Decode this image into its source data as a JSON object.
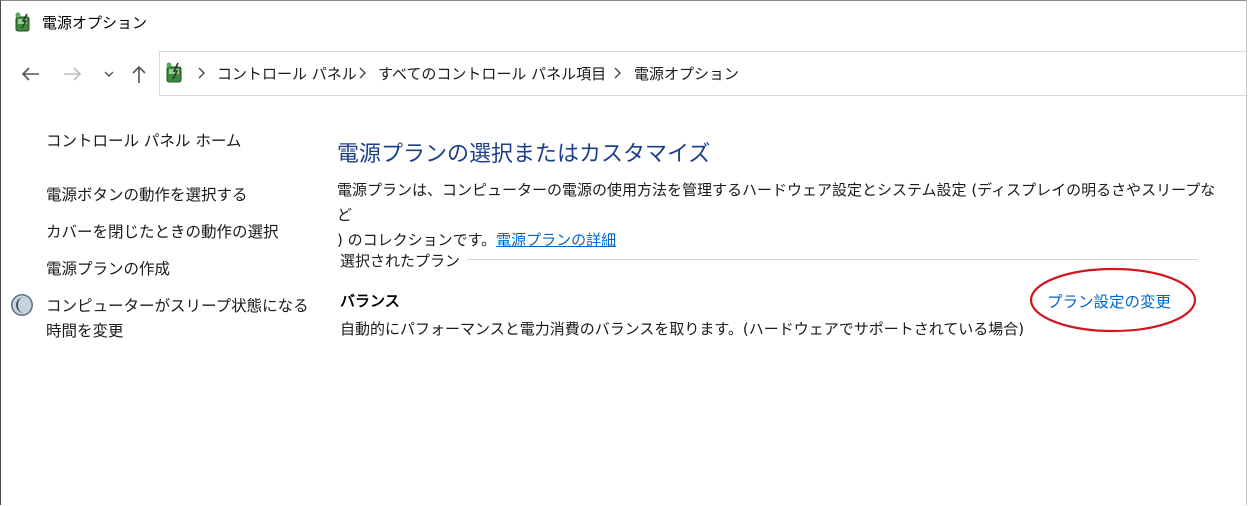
{
  "window": {
    "title": "電源オプション"
  },
  "breadcrumb": {
    "items": [
      "コントロール パネル",
      "すべてのコントロール パネル項目",
      "電源オプション"
    ]
  },
  "sidebar": {
    "home": "コントロール パネル ホーム",
    "links": [
      "電源ボタンの動作を選択する",
      "カバーを閉じたときの動作の選択",
      "電源プランの作成"
    ],
    "sleep_line1": "コンピューターがスリープ状態になる",
    "sleep_line2": "時間を変更"
  },
  "main": {
    "title": "電源プランの選択またはカスタマイズ",
    "description_line1": "電源プランは、コンピューターの電源の使用方法を管理するハードウェア設定とシステム設定 (ディスプレイの明るさやスリープなど",
    "description_line2": ") のコレクションです。",
    "details_link": "電源プランの詳細",
    "section_label": "選択されたプラン",
    "plan_name": "バランス",
    "plan_description": "自動的にパフォーマンスと電力消費のバランスを取ります。(ハードウェアでサポートされている場合)",
    "change_plan_link": "プラン設定の変更"
  },
  "colors": {
    "title_blue": "#1e3f8a",
    "link_blue": "#0066cc",
    "annotation_red": "#d0161e"
  }
}
